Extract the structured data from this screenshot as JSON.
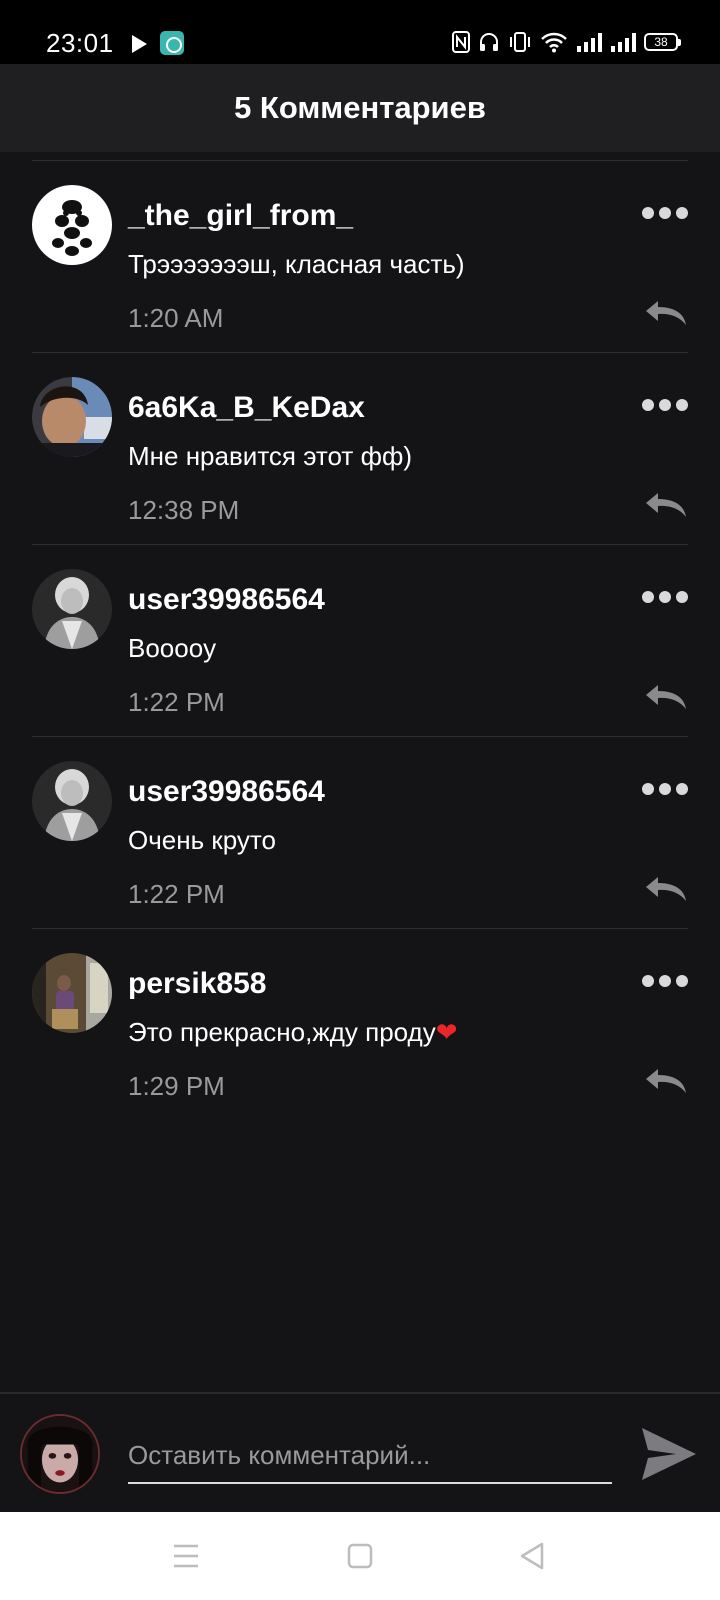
{
  "status_bar": {
    "time": "23:01",
    "battery": "38"
  },
  "header": {
    "title": "5 Комментариев"
  },
  "comments": [
    {
      "username": "_the_girl_from_",
      "text": "Трэээээээш, класная часть)",
      "time": "1:20 AM"
    },
    {
      "username": "6a6Ka_B_KeDax",
      "text": "Мне нравится этот фф)",
      "time": "12:38 PM"
    },
    {
      "username": "user39986564",
      "text": "Booooy",
      "time": "1:22 PM"
    },
    {
      "username": "user39986564",
      "text": "Очень круто",
      "time": "1:22 PM"
    },
    {
      "username": "persik858",
      "text": "Это прекрасно,жду проду",
      "emoji": "❤",
      "time": "1:29 PM"
    }
  ],
  "composer": {
    "placeholder": "Оставить комментарий..."
  },
  "icons": {
    "status": [
      "play-icon",
      "app-badge-icon",
      "nfc-icon",
      "headphones-icon",
      "vibrate-icon",
      "wifi-icon",
      "signal-icon",
      "signal-icon",
      "battery-icon"
    ],
    "comment_actions": [
      "more-dots-icon",
      "reply-arrow-icon"
    ],
    "composer": [
      "send-icon"
    ],
    "navigation": [
      "menu-icon",
      "home-square-icon",
      "back-triangle-icon"
    ]
  },
  "colors": {
    "background": "#141316",
    "header": "#1f1e21",
    "muted_text": "#9a999c",
    "heart": "#e8262b"
  }
}
